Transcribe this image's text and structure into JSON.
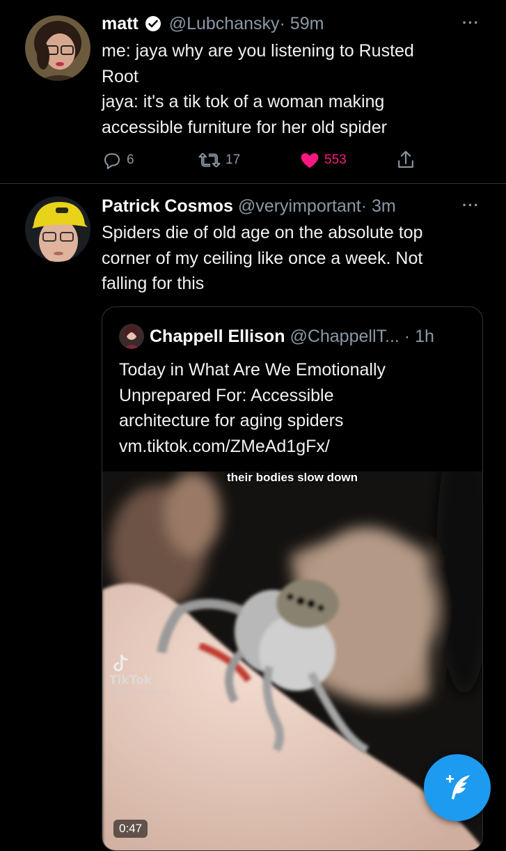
{
  "tweets": [
    {
      "name": "matt",
      "verified": true,
      "handle": "@Lubchansky",
      "time": "· 59m",
      "more": "···",
      "text": "me: jaya why are you listening to Rusted\nRoot\njaya: it's a tik tok of a woman making\naccessible furniture for her old spider",
      "replies": "6",
      "retweets": "17",
      "likes": "553",
      "liked": true
    },
    {
      "name": "Patrick Cosmos",
      "handle": "@veryimportant",
      "time": "· 3m",
      "more": "···",
      "text": "Spiders die of old age on the absolute top\ncorner of my ceiling like once a week. Not\nfalling for this"
    }
  ],
  "quote": {
    "name": "Chappell Ellison",
    "handle": "@ChappellT...",
    "time": "· 1h",
    "text": "Today in What Are We Emotionally\nUnprepared For: Accessible\narchitecture for aging spiders\nvm.tiktok.com/ZMeAd1gFx/",
    "video": {
      "caption": "their bodies slow down",
      "watermark": "TikTok",
      "watermark_user": "@little_spiderloving",
      "duration": "0:47"
    }
  },
  "colors": {
    "background": "#000000",
    "secondary_text": "#8b98a5",
    "like": "#f91880",
    "accent": "#1d9bf0"
  },
  "icons": [
    "verified-badge-icon",
    "more-icon",
    "reply-icon",
    "retweet-icon",
    "heart-icon",
    "share-icon",
    "tiktok-logo-icon",
    "compose-tweet-icon"
  ]
}
